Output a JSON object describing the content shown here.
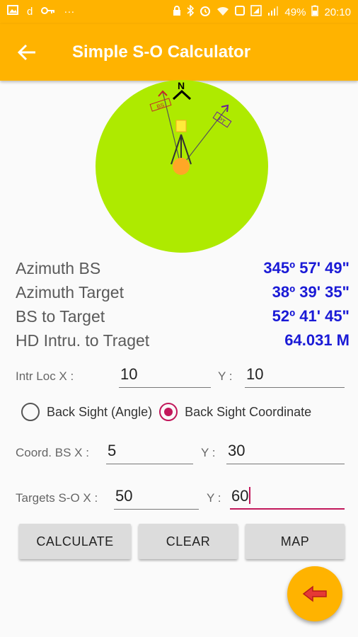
{
  "status": {
    "battery": "49%",
    "time": "20:10",
    "left_icons": [
      "image-icon",
      "d",
      "key-icon",
      "more-icon"
    ],
    "right_icons": [
      "lock-icon",
      "bluetooth-icon",
      "alarm-icon",
      "wifi-icon",
      "nfc-icon",
      "sim-icon",
      "signal-icon"
    ]
  },
  "appbar": {
    "title": "Simple S-O Calculator"
  },
  "compass": {
    "north": "N",
    "bs_label": "BS",
    "target_label": "PT",
    "circle_color": "#aeea00",
    "instrument_color": "#ffa726"
  },
  "results": [
    {
      "label": "Azimuth BS",
      "value": "345º 57' 49\""
    },
    {
      "label": "Azimuth Target",
      "value": "38º 39' 35\""
    },
    {
      "label": "BS to Target",
      "value": "52º 41' 45\""
    },
    {
      "label": "HD Intru. to Traget",
      "value": "64.031 M"
    }
  ],
  "intr": {
    "label": "Intr Loc X :",
    "x": "10",
    "y_label": "Y :",
    "y": "10"
  },
  "radio": {
    "opt1": "Back Sight (Angle)",
    "opt2": "Back Sight Coordinate",
    "selected": "opt2"
  },
  "coord_bs": {
    "label": "Coord. BS  X :",
    "x": "5",
    "y_label": "Y :",
    "y": "30"
  },
  "targets": {
    "label": "Targets  S-O X :",
    "x": "50",
    "y_label": "Y :",
    "y": "60"
  },
  "buttons": {
    "calculate": "CALCULATE",
    "clear": "CLEAR",
    "map": "MAP"
  },
  "colors": {
    "accent": "#ffb300",
    "value_blue": "#1a1ad6",
    "active": "#c2185b"
  }
}
